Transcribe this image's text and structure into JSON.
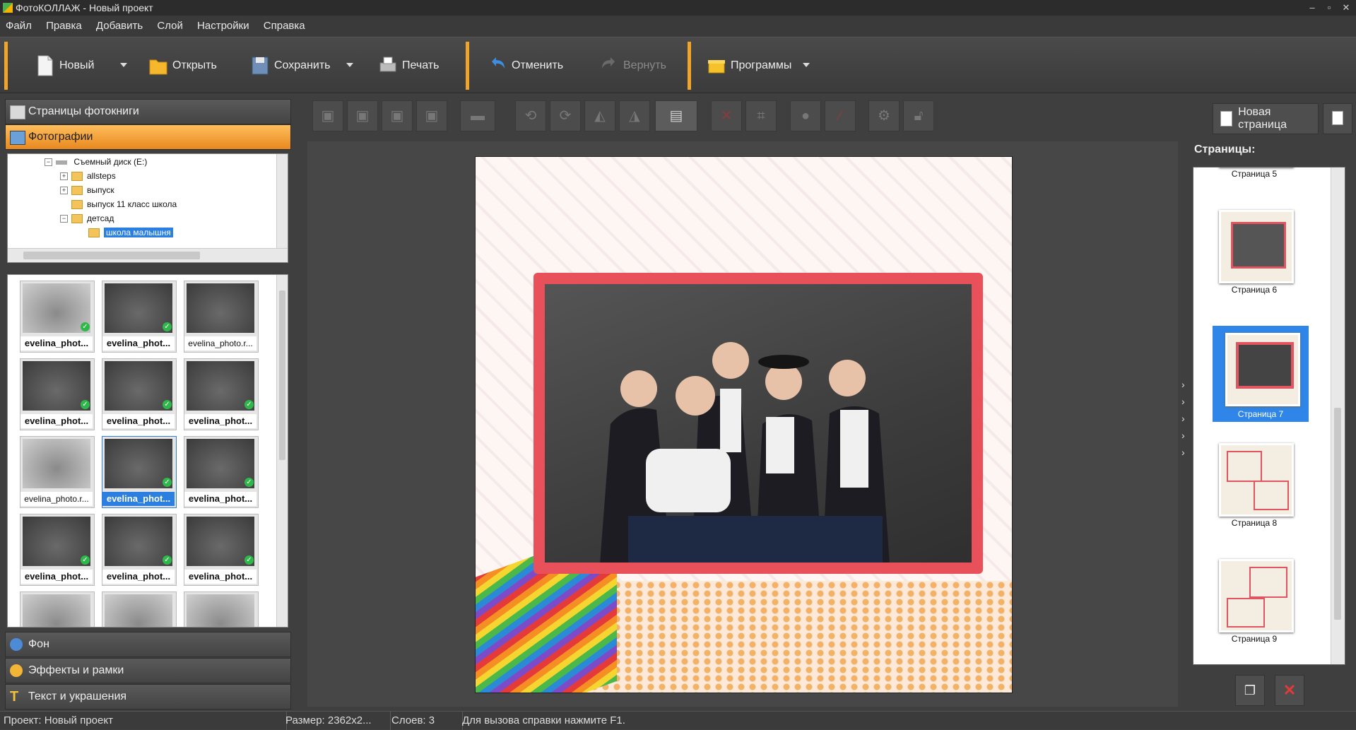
{
  "window": {
    "title": "ФотоКОЛЛАЖ - Новый проект"
  },
  "menu": [
    "Файл",
    "Правка",
    "Добавить",
    "Слой",
    "Настройки",
    "Справка"
  ],
  "toolbar": {
    "new": "Новый",
    "open": "Открыть",
    "save": "Сохранить",
    "print": "Печать",
    "undo": "Отменить",
    "redo": "Вернуть",
    "programs": "Программы"
  },
  "left_panel": {
    "sections": {
      "photobook_pages": "Страницы фотокниги",
      "photos": "Фотографии",
      "background": "Фон",
      "effects": "Эффекты и рамки",
      "text": "Текст и украшения"
    },
    "tree": [
      {
        "label": "Съемный диск (E:)",
        "expander": "⊟"
      },
      {
        "label": "allsteps",
        "expander": "⊞"
      },
      {
        "label": "выпуск",
        "expander": "⊞"
      },
      {
        "label": "выпуск 11 класс школа",
        "expander": ""
      },
      {
        "label": "детсад",
        "expander": "⊟"
      },
      {
        "label": "школа малышня",
        "expander": "",
        "selected": true
      }
    ],
    "thumbnails": [
      {
        "caption": "evelina_phot...",
        "checked": true
      },
      {
        "caption": "evelina_phot...",
        "checked": true
      },
      {
        "caption": "evelina_photo.r...",
        "checked": false
      },
      {
        "caption": "evelina_phot...",
        "checked": true
      },
      {
        "caption": "evelina_phot...",
        "checked": true
      },
      {
        "caption": "evelina_phot...",
        "checked": true
      },
      {
        "caption": "evelina_photo.r...",
        "checked": false
      },
      {
        "caption": "evelina_phot...",
        "checked": true,
        "selected": true
      },
      {
        "caption": "evelina_phot...",
        "checked": true
      },
      {
        "caption": "evelina_phot...",
        "checked": true
      },
      {
        "caption": "evelina_phot...",
        "checked": true
      },
      {
        "caption": "evelina_phot...",
        "checked": true
      }
    ]
  },
  "right_panel": {
    "new_page": "Новая страница",
    "pages_title": "Страницы:",
    "pages": [
      "Страница 5",
      "Страница 6",
      "Страница 7",
      "Страница 8",
      "Страница 9"
    ],
    "selected_page": "Страница 7"
  },
  "status": {
    "project": "Проект:  Новый проект",
    "size": "Размер:  2362x2...",
    "layers": "Слоев:  3",
    "hint": "Для вызова справки нажмите F1."
  },
  "colors": {
    "accent": "#f0a52a",
    "selection": "#2f86e8",
    "frame": "#e8505a"
  }
}
